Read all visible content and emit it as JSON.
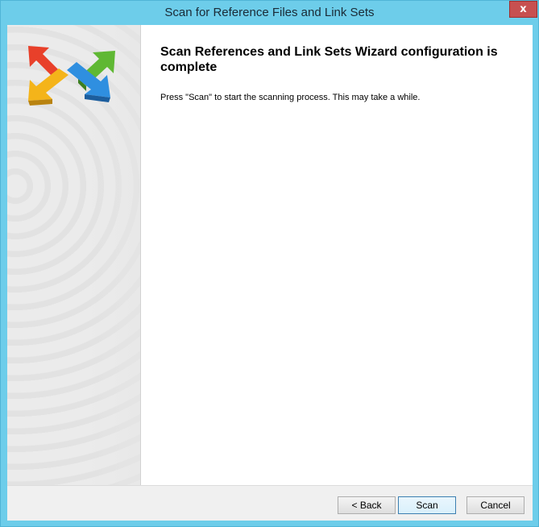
{
  "window": {
    "title": "Scan for Reference Files and Link Sets",
    "close_label": "x"
  },
  "side_panel": {
    "logo_icon": "multi-direction-arrows-icon",
    "colors": {
      "arrow_red": "#e8402a",
      "arrow_green": "#5fb833",
      "arrow_yellow": "#f4b41a",
      "arrow_blue": "#2f8fe0"
    }
  },
  "main": {
    "heading": "Scan References and Link Sets Wizard configuration is complete",
    "description": "Press \"Scan\" to start the scanning process. This may take a while."
  },
  "buttons": {
    "back_label": "< Back",
    "scan_label": "Scan",
    "cancel_label": "Cancel"
  },
  "colors": {
    "title_bar": "#6dcdea",
    "close_button": "#c75050",
    "default_button_border": "#3c7fb1"
  }
}
